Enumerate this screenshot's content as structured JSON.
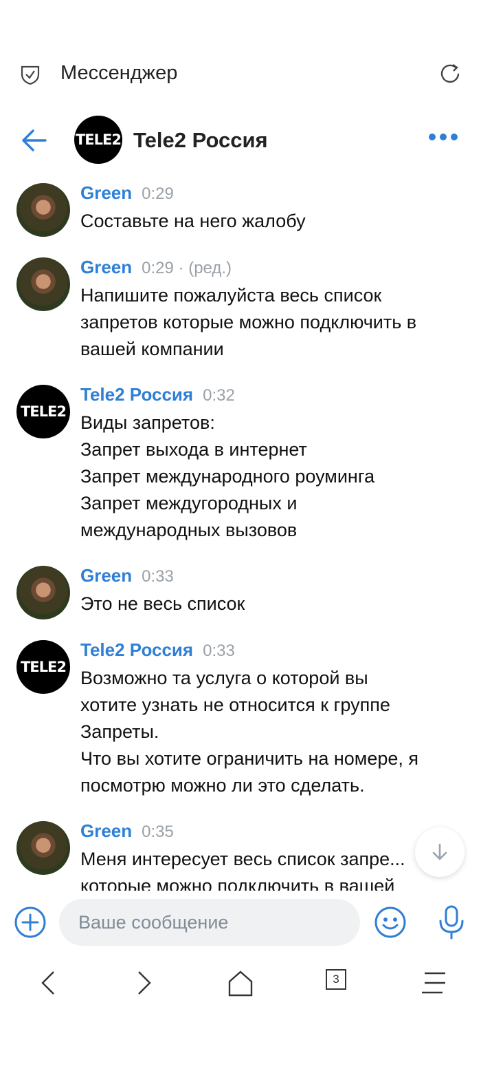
{
  "browser": {
    "title": "Мессенджер"
  },
  "chat": {
    "name": "Tele2 Россия",
    "avatar_text": "TELE2"
  },
  "messages": [
    {
      "author": "Green",
      "time": "0:29",
      "text": "Составьте на него жалобу",
      "avatar": "photo"
    },
    {
      "author": "Green",
      "time": "0:29 · (ред.)",
      "text": "Напишите пожалуйста весь список\nзапретов которые можно подключить в\nвашей компании",
      "avatar": "photo"
    },
    {
      "author": "Tele2 Россия",
      "time": "0:32",
      "text": "Виды запретов:\nЗапрет выхода в интернет\nЗапрет международного роуминга\nЗапрет междугородных и\nмеждународных вызовов",
      "avatar": "tele2"
    },
    {
      "author": "Green",
      "time": "0:33",
      "text": "Это не весь список",
      "avatar": "photo"
    },
    {
      "author": "Tele2 Россия",
      "time": "0:33",
      "text": "Возможно та услуга о которой вы\nхотите узнать не относится к группе\nЗапреты.\nЧто вы хотите ограничить на номере, я\nпосмотрю можно ли это сделать.",
      "avatar": "tele2"
    },
    {
      "author": "Green",
      "time": "0:35",
      "text": "Меня интересует весь список запре...\nкоторые можно подключить в вашей",
      "avatar": "photo"
    }
  ],
  "composer": {
    "placeholder": "Ваше сообщение"
  },
  "nav": {
    "tabs_count": "3"
  },
  "colors": {
    "accent": "#2f7fd6",
    "time": "#9aa0a6"
  }
}
